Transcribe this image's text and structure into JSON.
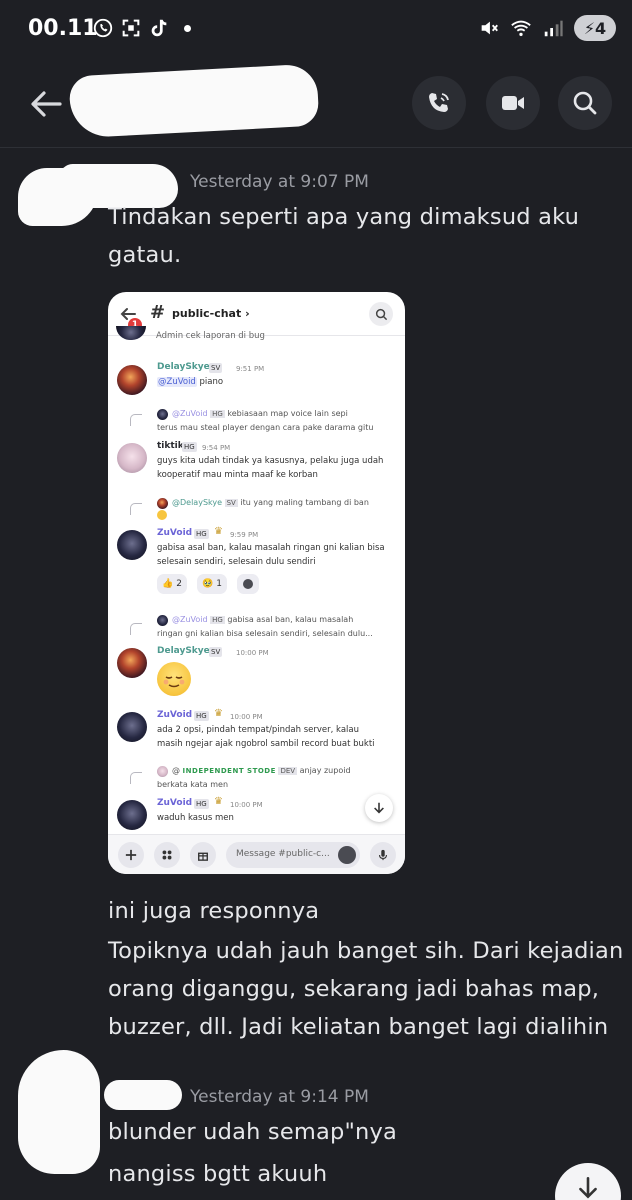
{
  "status_bar": {
    "time": "00.11",
    "battery": "4",
    "icons": [
      "whatsapp-icon",
      "scan-icon",
      "tiktok-icon",
      "mute-icon",
      "wifi-icon",
      "signal-icon",
      "battery-icon"
    ]
  },
  "header": {
    "icons": [
      "back-arrow-icon",
      "phone-icon",
      "video-camera-icon",
      "search-icon"
    ]
  },
  "messages": [
    {
      "timestamp": "Yesterday at 9:07 PM",
      "lines": [
        "Tindakan seperti apa yang dimaksud aku",
        "gatau."
      ]
    },
    {
      "lines": [
        "ini juga responnya",
        "Topiknya udah jauh banget sih. Dari kejadian",
        "orang diganggu, sekarang jadi bahas map,",
        "buzzer, dll. Jadi keliatan banget lagi dialihin"
      ]
    },
    {
      "timestamp": "Yesterday at 9:14 PM",
      "lines": [
        "blunder udah semap\"nya",
        "nangiss bgtt akuuh"
      ]
    }
  ],
  "embedded_screenshot": {
    "channel": "public-chat",
    "badge": "1",
    "partial_top_text": "Admin cek laporan di bug",
    "msg1": {
      "name": "DelaySkye",
      "tag": "SV",
      "time": "9:51 PM",
      "mention": "@ZuVoid",
      "text": "piano"
    },
    "msg2": {
      "reply_name": "@ZuVoid",
      "reply_tag": "HG",
      "reply_text_1": "kebiasaan map voice lain sepi",
      "reply_text_2": "terus mau steal player dengan cara pake darama gitu",
      "name": "tiktik",
      "tag": "HG",
      "time": "9:54 PM",
      "text_1": "guys kita udah tindak ya kasusnya, pelaku juga udah",
      "text_2": "kooperatif mau minta maaf ke korban"
    },
    "msg3": {
      "reply_name": "@DelaySkye",
      "reply_tag": "SV",
      "reply_text": "itu yang maling tambang di ban",
      "name": "ZuVoid",
      "tag": "HG",
      "time": "9:59 PM",
      "text_1": "gabisa asal ban, kalau masalah ringan gni kalian bisa",
      "text_2": "selesain sendiri, selesain dulu sendiri",
      "reactions": [
        {
          "emoji": "👍",
          "count": "2"
        },
        {
          "emoji": "🥹",
          "count": "1"
        }
      ]
    },
    "msg4": {
      "reply_name": "@ZuVoid",
      "reply_tag": "HG",
      "reply_text_1": "gabisa asal ban, kalau masalah",
      "reply_text_2": "ringan gni kalian bisa selesain sendiri, selesain dulu...",
      "name": "DelaySkye",
      "tag": "SV",
      "time": "10:00 PM"
    },
    "msg5": {
      "name": "ZuVoid",
      "tag": "HG",
      "time": "10:00 PM",
      "text_1": "ada 2 opsi, pindah tempat/pindah server, kalau",
      "text_2": "masih ngejar ajak ngobrol sambil record buat bukti"
    },
    "msg6": {
      "reply_prefix": "@",
      "reply_name": "INDEPENDENT STODE",
      "reply_tag": "DEV",
      "reply_text_1": "anjay zupoid",
      "reply_text_2": "berkata kata men",
      "name": "ZuVoid",
      "tag": "HG",
      "time": "10:00 PM",
      "text": "waduh kasus men"
    },
    "input_placeholder": "Message #public-c..."
  }
}
